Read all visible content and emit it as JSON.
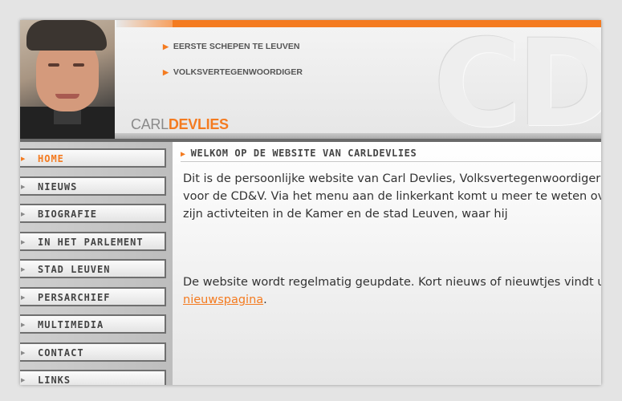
{
  "header": {
    "tagline1": "EERSTE SCHEPEN TE LEUVEN",
    "tagline2": "VOLKSVERTEGENWOORDIGER",
    "name_first": "CARL",
    "name_last": "DEVLIES",
    "watermark": "CD",
    "accent_color": "#f47b20"
  },
  "nav": {
    "items": [
      {
        "label": "HOME",
        "active": true
      },
      {
        "label": "NIEUWS"
      },
      {
        "label": "BIOGRAFIE"
      },
      {
        "label": "IN HET PARLEMENT"
      },
      {
        "label": "STAD LEUVEN"
      },
      {
        "label": "PERSARCHIEF"
      },
      {
        "label": "MULTIMEDIA"
      },
      {
        "label": "CONTACT"
      },
      {
        "label": "LINKS"
      }
    ]
  },
  "main": {
    "title": "WELKOM OP DE WEBSITE VAN CARLDEVLIES",
    "para1_lines": [
      "Dit is de persoonlijke website van Carl Devlies, Volksvertegenwoordiger",
      "voor de CD&V. Via het menu aan de linkerkant komt u meer te weten over",
      "zijn activteiten in de Kamer en de stad Leuven, waar hij"
    ],
    "para2_line1": "De website wordt regelmatig geupdate. Kort nieuws of nieuwtjes vindt u op de",
    "para2_link": "nieuwspagina",
    "para2_end": "."
  }
}
